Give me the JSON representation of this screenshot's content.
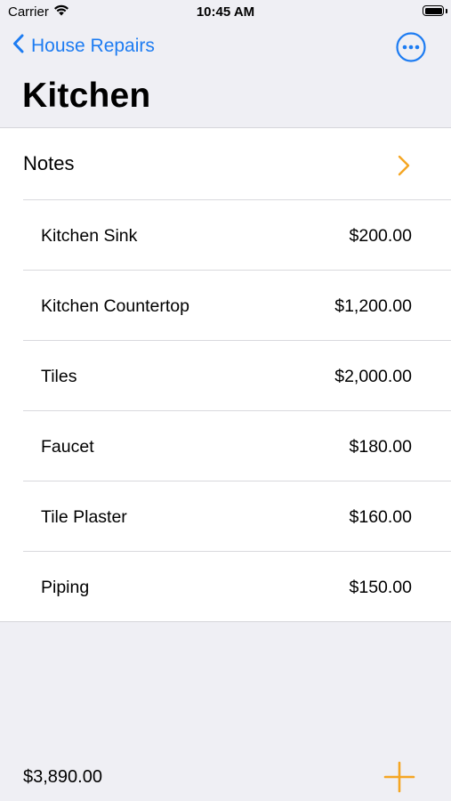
{
  "status_bar": {
    "carrier": "Carrier",
    "time": "10:45 AM"
  },
  "nav": {
    "back_label": "House Repairs",
    "title": "Kitchen"
  },
  "notes": {
    "label": "Notes"
  },
  "items": [
    {
      "name": "Kitchen Sink",
      "price": "$200.00"
    },
    {
      "name": "Kitchen Countertop",
      "price": "$1,200.00"
    },
    {
      "name": "Tiles",
      "price": "$2,000.00"
    },
    {
      "name": "Faucet",
      "price": "$180.00"
    },
    {
      "name": "Tile Plaster",
      "price": "$160.00"
    },
    {
      "name": "Piping",
      "price": "$150.00"
    }
  ],
  "footer": {
    "total": "$3,890.00"
  },
  "colors": {
    "tint": "#1d7cf2",
    "accent": "#f5a623",
    "background": "#efeff4"
  },
  "icons": {
    "wifi": "wifi-icon",
    "battery": "battery-icon",
    "back": "chevron-left-icon",
    "more": "ellipsis-circle-icon",
    "notes_disclosure": "chevron-right-icon",
    "add": "plus-icon"
  }
}
